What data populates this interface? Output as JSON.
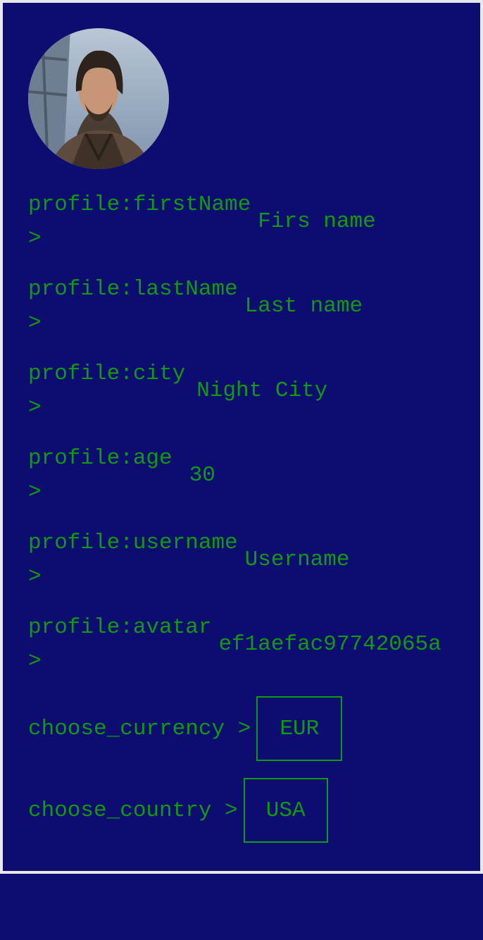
{
  "profile": {
    "avatar_alt": "profile avatar",
    "fields": [
      {
        "label": "profile:firstName\n>",
        "value": "Firs name"
      },
      {
        "label": "profile:lastName\n>",
        "value": "Last name"
      },
      {
        "label": "profile:city\n>",
        "value": "Night City"
      },
      {
        "label": "profile:age\n>",
        "value": "30"
      },
      {
        "label": "profile:username\n>",
        "value": "Username"
      },
      {
        "label": "profile:avatar\n>",
        "value": "ef1aefac97742065a"
      }
    ]
  },
  "settings": {
    "currency_label": "choose_currency >",
    "currency_value": "EUR",
    "country_label": "choose_country >",
    "country_value": "USA"
  },
  "colors": {
    "background": "#0d0c70",
    "text": "#0f9a0f",
    "border": "#e8e8e8"
  }
}
